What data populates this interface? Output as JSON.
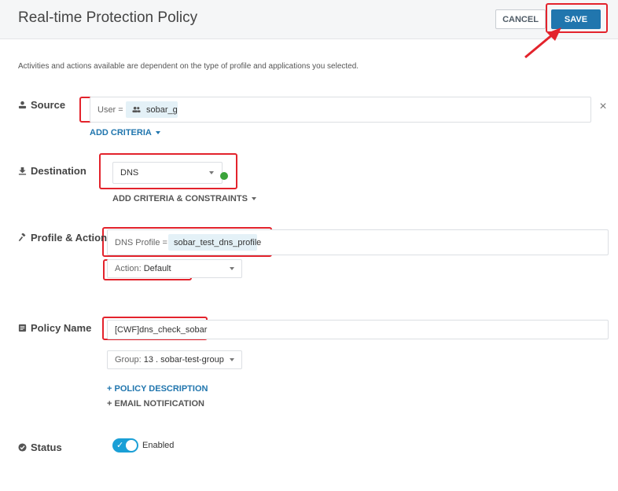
{
  "header": {
    "title": "Real-time Protection Policy",
    "cancel_label": "CANCEL",
    "save_label": "SAVE"
  },
  "note": "Activities and actions available are dependent on the type of profile and applications you selected.",
  "source": {
    "label": "Source",
    "criteria_key": "User =",
    "criteria_value": "sobar_g",
    "add_criteria": "ADD CRITERIA"
  },
  "destination": {
    "label": "Destination",
    "selected": "DNS",
    "add_criteria": "ADD CRITERIA & CONSTRAINTS"
  },
  "profile": {
    "label": "Profile & Action",
    "profile_key": "DNS Profile =",
    "profile_value": "sobar_test_dns_profile",
    "action_key": "Action:",
    "action_value": "Default"
  },
  "policy": {
    "label": "Policy Name",
    "name_value": "[CWF]dns_check_sobar",
    "group_key": "Group:",
    "group_value": "13 . sobar-test-group",
    "policy_description": "+ POLICY DESCRIPTION",
    "email_notification": "+ EMAIL NOTIFICATION"
  },
  "status": {
    "label": "Status",
    "toggle_text": "Enabled",
    "enabled": true
  },
  "colors": {
    "accent": "#2176ae",
    "highlight": "#e3232c",
    "toggle_on": "#1a9fd6",
    "status_dot": "#3aa33a"
  },
  "icons": [
    "user-icon",
    "destination-icon",
    "gavel-icon",
    "document-icon",
    "check-circle-icon",
    "group-icon",
    "close-icon",
    "check-icon"
  ]
}
